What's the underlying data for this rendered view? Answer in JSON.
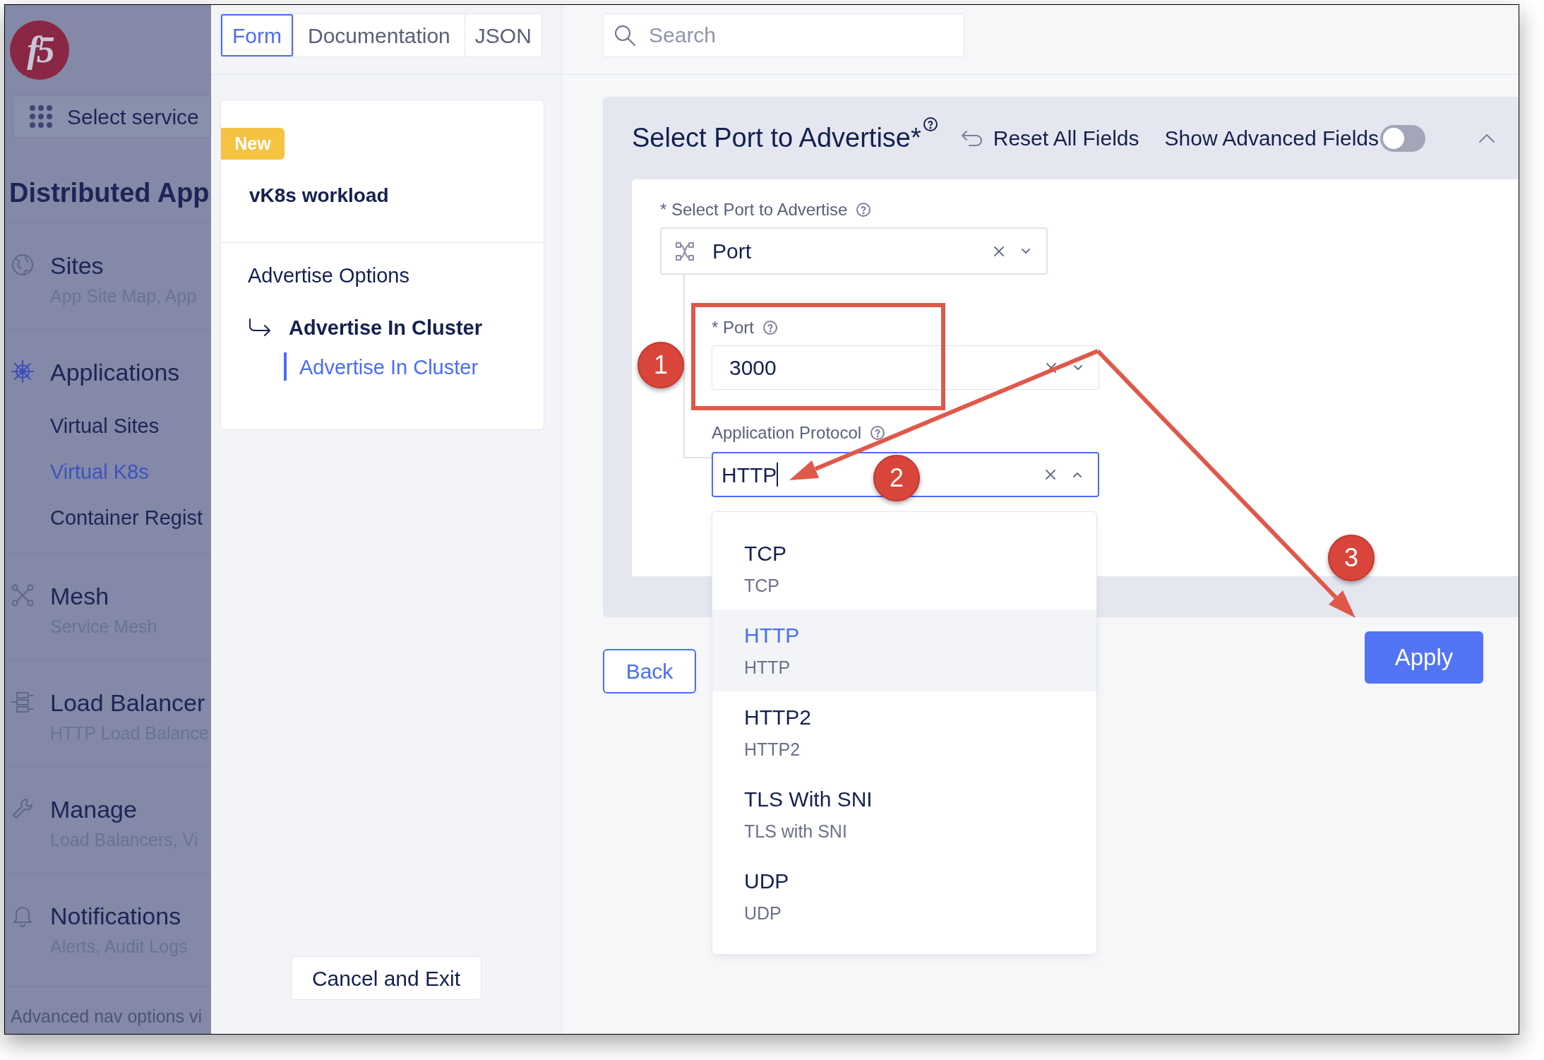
{
  "sidebar": {
    "logo": "f5",
    "select_service": "Select service",
    "heading": "Distributed App",
    "sections": [
      {
        "kind": "sites",
        "title": "Sites",
        "subtitle": "App Site Map, App"
      },
      {
        "kind": "applications",
        "title": "Applications",
        "children": [
          {
            "label": "Virtual Sites",
            "selected": false
          },
          {
            "label": "Virtual K8s",
            "selected": true
          },
          {
            "label": "Container Regist",
            "selected": false
          }
        ]
      },
      {
        "kind": "mesh",
        "title": "Mesh",
        "subtitle": "Service Mesh"
      },
      {
        "kind": "load_balancers",
        "title": "Load Balancer",
        "subtitle": "HTTP Load Balance"
      },
      {
        "kind": "manage",
        "title": "Manage",
        "subtitle": "Load Balancers, Vi"
      },
      {
        "kind": "notifications",
        "title": "Notifications",
        "subtitle": "Alerts, Audit Logs"
      }
    ],
    "footer": "Advanced nav options vi"
  },
  "tabs": [
    {
      "label": "Form",
      "selected": true
    },
    {
      "label": "Documentation",
      "selected": false
    },
    {
      "label": "JSON",
      "selected": false
    }
  ],
  "outline": {
    "badge": "New",
    "title": "vK8s workload",
    "items": [
      {
        "kind": "group",
        "label": "Advertise Options"
      },
      {
        "kind": "section",
        "label": "Advertise In Cluster"
      },
      {
        "kind": "link",
        "label": "Advertise In Cluster",
        "selected": true
      }
    ]
  },
  "cancel_button": "Cancel and Exit",
  "search": {
    "placeholder": "Search"
  },
  "section": {
    "title": "Select Port to Advertise*",
    "reset": "Reset All Fields",
    "advanced_fields": {
      "label": "Show Advanced Fields",
      "on": false
    },
    "expanded": true
  },
  "port_choice": {
    "label": "* Select Port to Advertise",
    "value": "Port"
  },
  "port": {
    "label": "* Port",
    "value": "3000"
  },
  "protocol": {
    "label": "Application Protocol",
    "value": "HTTP",
    "open": true,
    "options": [
      {
        "title": "TCP",
        "subtitle": "TCP",
        "selected": false
      },
      {
        "title": "HTTP",
        "subtitle": "HTTP",
        "selected": true
      },
      {
        "title": "HTTP2",
        "subtitle": "HTTP2",
        "selected": false
      },
      {
        "title": "TLS With SNI",
        "subtitle": "TLS with SNI",
        "selected": false
      },
      {
        "title": "UDP",
        "subtitle": "UDP",
        "selected": false
      }
    ]
  },
  "back_button": "Back",
  "apply_button": "Apply",
  "callouts": [
    "1",
    "2",
    "3"
  ]
}
